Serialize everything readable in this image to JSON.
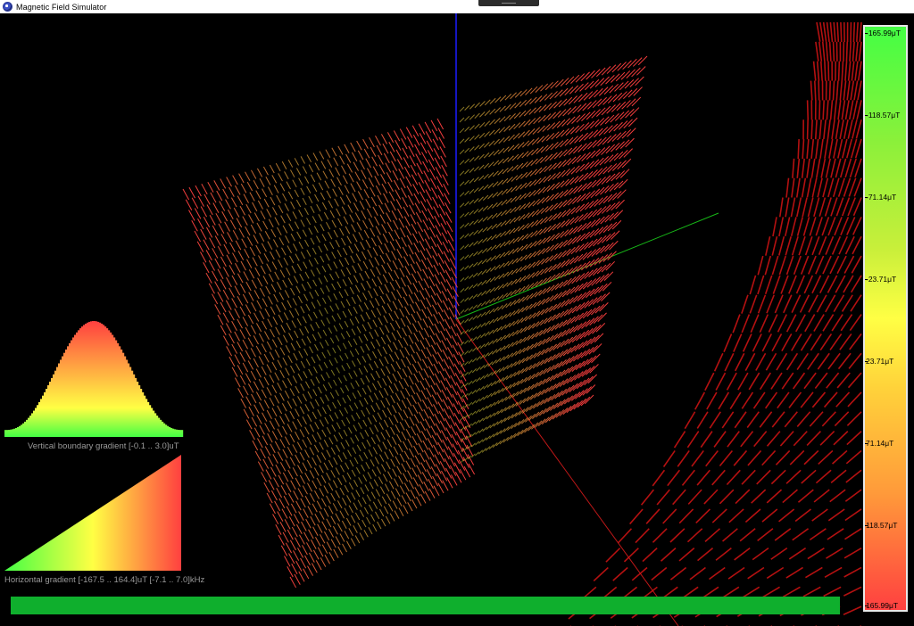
{
  "window": {
    "title": "Magnetic Field Simulator"
  },
  "colorbar": {
    "ticks": [
      "-165.99μT",
      "-118.57μT",
      "-71.14μT",
      "-23.71μT",
      "23.71μT",
      "71.14μT",
      "118.57μT",
      "165.99μT"
    ],
    "colors": [
      "#44ff44",
      "#ffff44",
      "#ff4040"
    ]
  },
  "insets": {
    "vertical_label": "Vertical boundary gradient [-0.1 .. 3.0]uT",
    "horizontal_label": "Horizontal gradient [-167.5 .. 164.4]uT [-7.1 .. 7.0]kHz"
  },
  "axes_colors": {
    "x": "#c01818",
    "y": "#17b617",
    "z": "#1c1cff"
  },
  "progress": {
    "fraction": 1.0,
    "color": "#0faf2d"
  }
}
